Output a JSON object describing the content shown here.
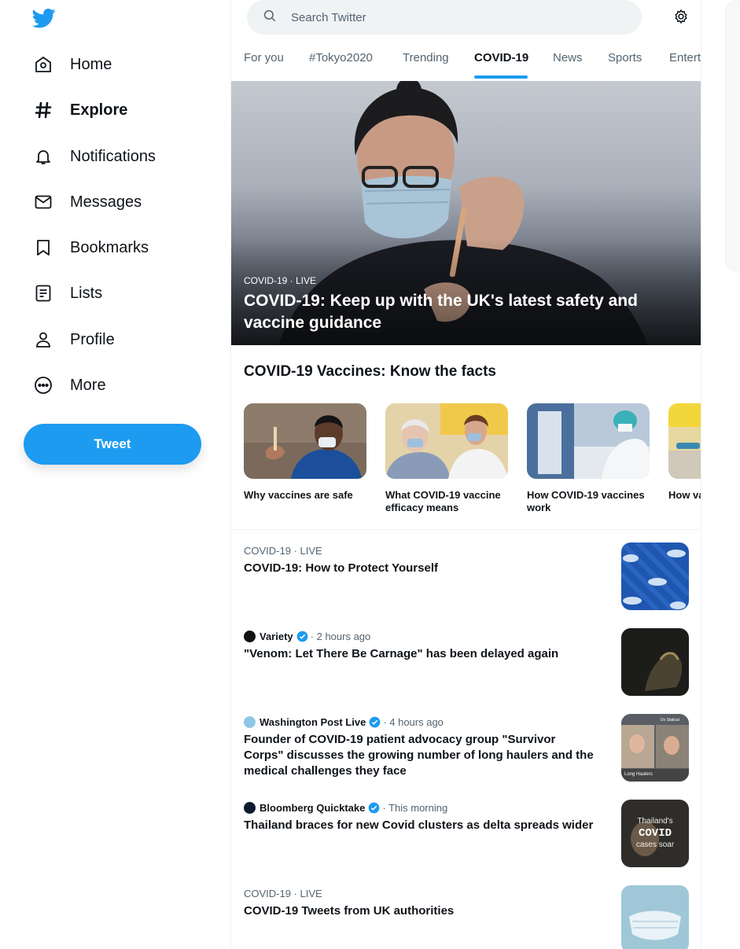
{
  "sidebar": {
    "items": [
      {
        "label": "Home",
        "icon": "home-icon"
      },
      {
        "label": "Explore",
        "icon": "hashtag-icon"
      },
      {
        "label": "Notifications",
        "icon": "bell-icon"
      },
      {
        "label": "Messages",
        "icon": "envelope-icon"
      },
      {
        "label": "Bookmarks",
        "icon": "bookmark-icon"
      },
      {
        "label": "Lists",
        "icon": "list-icon"
      },
      {
        "label": "Profile",
        "icon": "person-icon"
      },
      {
        "label": "More",
        "icon": "more-circle-icon"
      }
    ],
    "active": "Explore",
    "tweet_label": "Tweet"
  },
  "search": {
    "placeholder": "Search Twitter"
  },
  "tabs": [
    {
      "label": "For you"
    },
    {
      "label": "#Tokyo2020"
    },
    {
      "label": "Trending"
    },
    {
      "label": "COVID-19"
    },
    {
      "label": "News"
    },
    {
      "label": "Sports"
    },
    {
      "label": "Entert"
    }
  ],
  "active_tab": "COVID-19",
  "hero": {
    "meta": "COVID-19 · LIVE",
    "title": "COVID-19: Keep up with the UK's latest safety and vaccine guidance"
  },
  "vaccines_section": {
    "title": "COVID-19 Vaccines: Know the facts",
    "cards": [
      {
        "title": "Why vaccines are safe"
      },
      {
        "title": "What COVID-19 vaccine efficacy means"
      },
      {
        "title": "How COVID-19 vaccines work"
      },
      {
        "title": "How va distrib"
      }
    ]
  },
  "stories": [
    {
      "meta": "COVID-19 · LIVE",
      "source": "",
      "time": "",
      "title": "COVID-19: How to Protect Yourself"
    },
    {
      "meta": "",
      "source": "Variety",
      "time": "· 2 hours ago",
      "title": "\"Venom: Let There Be Carnage\" has been delayed again"
    },
    {
      "meta": "",
      "source": "Washington Post Live",
      "time": "· 4 hours ago",
      "title": "Founder of COVID-19 patient advocacy group \"Survivor Corps\" discusses the growing number of long haulers and the medical challenges they face"
    },
    {
      "meta": "",
      "source": "Bloomberg Quicktake",
      "time": "· This morning",
      "title": "Thailand braces for new Covid clusters as delta spreads wider"
    },
    {
      "meta": "COVID-19 · LIVE",
      "source": "",
      "time": "",
      "title": "COVID-19 Tweets from UK authorities"
    }
  ],
  "thumb_text": {
    "wapo_top": "Dx Statical",
    "wapo_bottom": "Long Haulers",
    "thailand_line1": "Thailand's",
    "thailand_line2": "COVID",
    "thailand_line3": "cases soar"
  },
  "colors": {
    "accent": "#1d9bf0",
    "text": "#0f1419",
    "muted": "#536471",
    "border": "#eff3f4"
  }
}
